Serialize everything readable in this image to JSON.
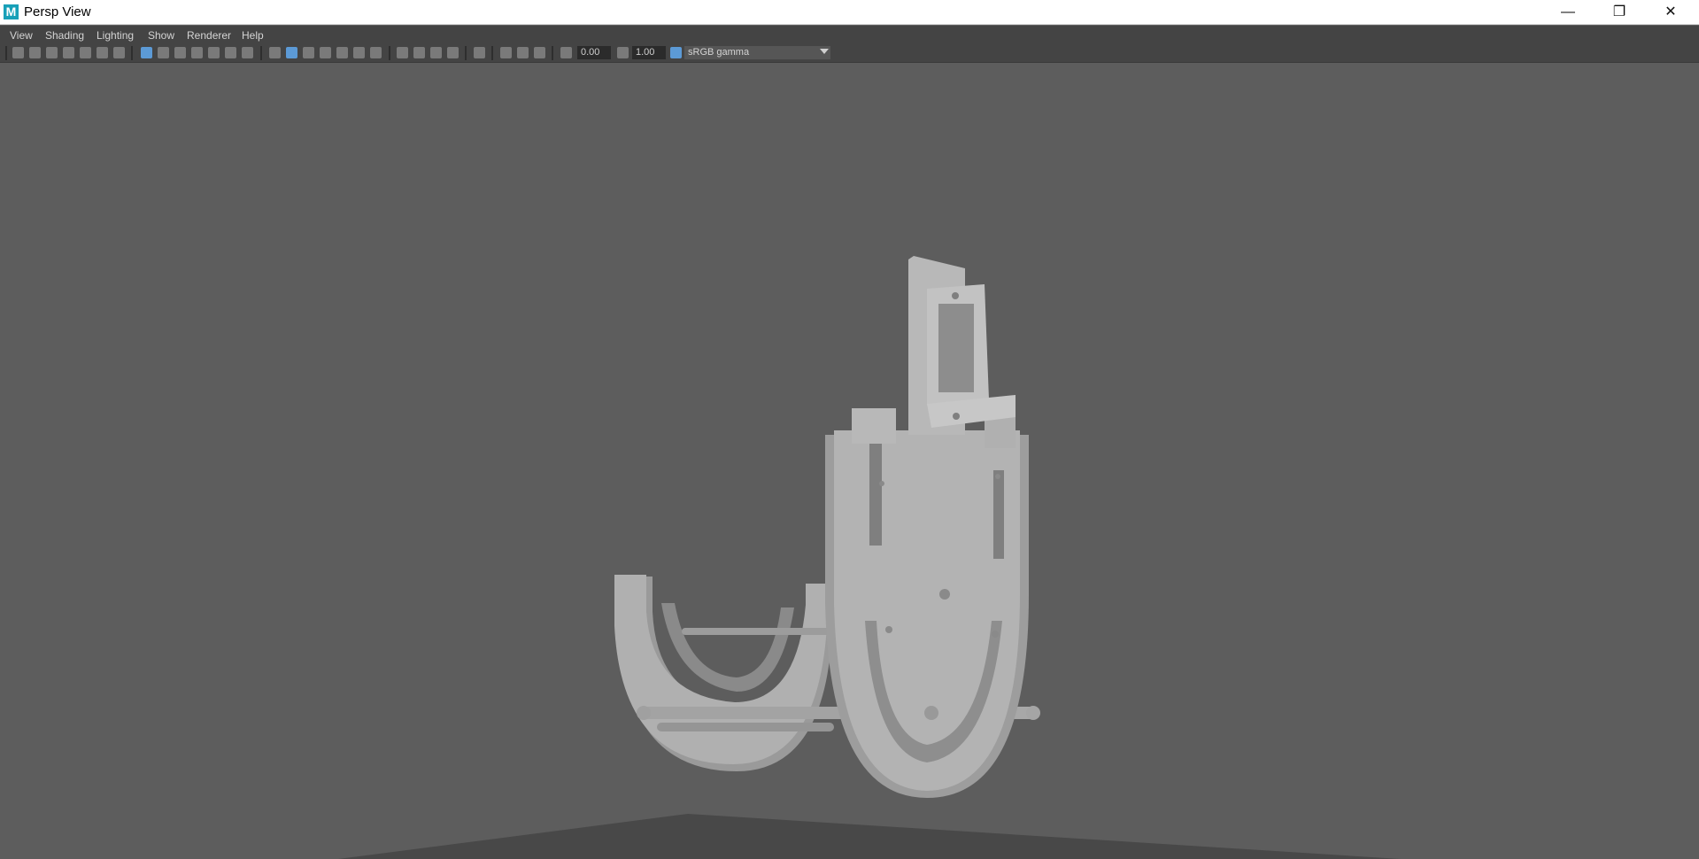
{
  "window": {
    "title": "Persp View",
    "app_icon_letter": "M",
    "controls": {
      "minimize": "—",
      "restore": "❐",
      "close": "✕"
    }
  },
  "menu": {
    "items": [
      "View",
      "Shading",
      "Lighting",
      "Show",
      "Renderer",
      "Help"
    ]
  },
  "toolbar": {
    "exposure_value": "0.00",
    "gamma_value": "1.00",
    "color_space": "sRGB gamma"
  },
  "colors": {
    "viewport_bg": "#5d5d5d",
    "ui_bg": "#444444",
    "active_icon": "#5c9ad6",
    "model": "#b4b4b4"
  }
}
